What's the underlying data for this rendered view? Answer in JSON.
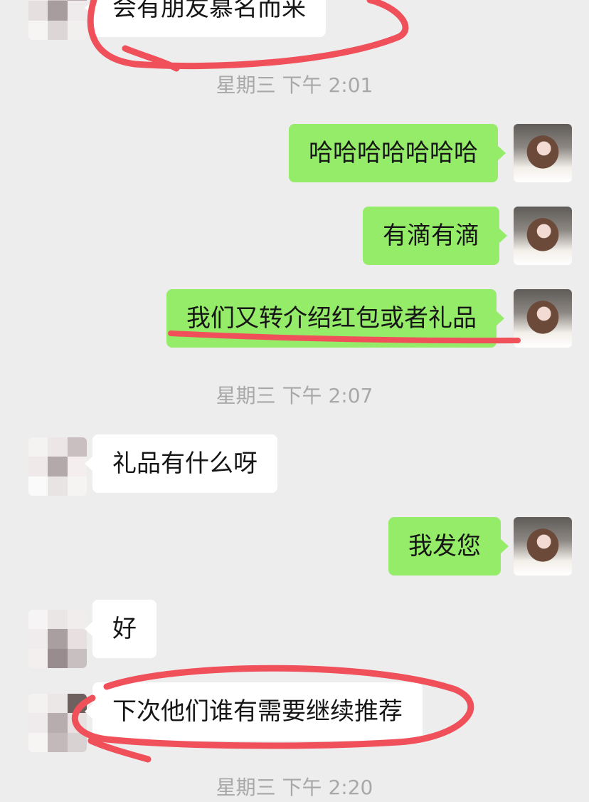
{
  "timestamps": [
    "星期三 下午 2:01",
    "星期三 下午 2:07",
    "星期三 下午 2:20"
  ],
  "messages": [
    {
      "side": "in",
      "text": "会有朋友慕名而来"
    },
    {
      "side": "out",
      "text": "哈哈哈哈哈哈哈"
    },
    {
      "side": "out",
      "text": "有滴有滴"
    },
    {
      "side": "out",
      "text": "我们又转介绍红包或者礼品"
    },
    {
      "side": "in",
      "text": "礼品有什么呀"
    },
    {
      "side": "out",
      "text": "我发您"
    },
    {
      "side": "in",
      "text": "好"
    },
    {
      "side": "in",
      "text": "下次他们谁有需要继续推荐"
    }
  ],
  "avatars": {
    "contact": "pixelated-avatar",
    "self": "profile-photo"
  },
  "colors": {
    "background": "#ededed",
    "incoming": "#ffffff",
    "outgoing": "#95ec69",
    "annotation": "#f0505a",
    "timestamp": "#a8a8a8"
  }
}
